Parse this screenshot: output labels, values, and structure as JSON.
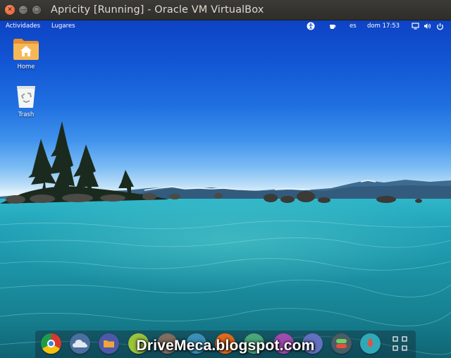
{
  "window": {
    "title": "Apricity [Running] - Oracle VM VirtualBox",
    "buttons": {
      "close_glyph": "✕",
      "minimize_glyph": "—",
      "maximize_glyph": "▢"
    }
  },
  "panel": {
    "activities": "Actividades",
    "places": "Lugares",
    "language": "es",
    "clock": "dom 17:53",
    "icons": [
      "accessibility-icon",
      "coffee-cup-icon",
      "screen-icon",
      "volume-icon",
      "power-icon"
    ]
  },
  "desktop": {
    "icons": [
      {
        "label": "Home",
        "icon": "home-folder-icon"
      },
      {
        "label": "Trash",
        "icon": "trash-icon"
      }
    ]
  },
  "dock": {
    "apps": [
      {
        "icon": "chrome-icon",
        "color": "#d8382c"
      },
      {
        "icon": "cloud-icon",
        "color": "#4a6fa0"
      },
      {
        "icon": "files-icon",
        "color": "#4e58a8"
      },
      {
        "icon": "app-icon",
        "color": "#9bc43b"
      },
      {
        "icon": "app-icon",
        "color": "#7f6d60"
      },
      {
        "icon": "app-icon",
        "color": "#3a8fb6"
      },
      {
        "icon": "app-icon",
        "color": "#e06a1f"
      },
      {
        "icon": "app-icon",
        "color": "#4aa67a"
      },
      {
        "icon": "app-icon",
        "color": "#a04bb0"
      },
      {
        "icon": "app-icon",
        "color": "#6270c0"
      },
      {
        "icon": "toggle-icon",
        "color": "#4c5b64"
      },
      {
        "icon": "download-icon",
        "color": "#2fa9b8"
      },
      {
        "icon": "show-apps-icon",
        "color": "#2e3a44"
      }
    ]
  },
  "watermark": "DriveMeca.blogspot.com"
}
